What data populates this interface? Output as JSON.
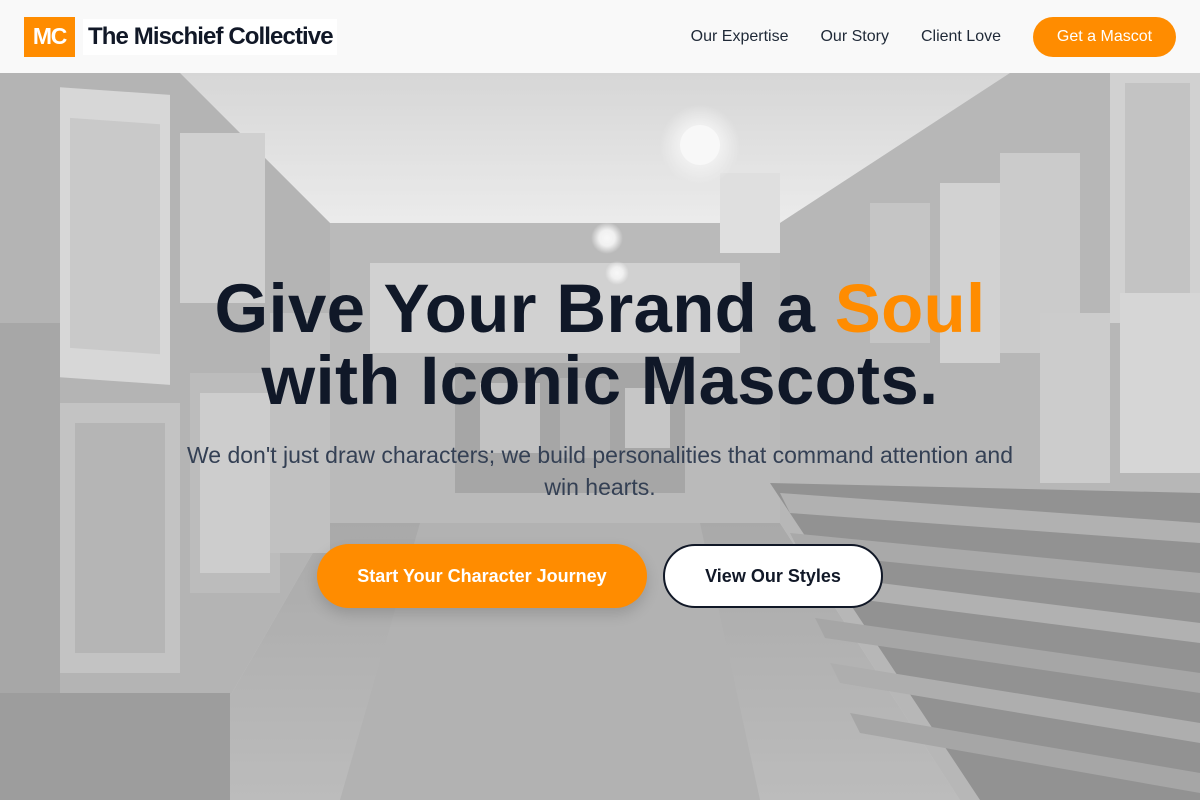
{
  "header": {
    "logo_mark": "MC",
    "brand_name": "The Mischief Collective",
    "nav": [
      {
        "label": "Our Expertise"
      },
      {
        "label": "Our Story"
      },
      {
        "label": "Client Love"
      }
    ],
    "cta_label": "Get a Mascot"
  },
  "hero": {
    "title_part1": "Give Your Brand a ",
    "title_accent": "Soul",
    "title_line2": "with Iconic Mascots.",
    "subtitle": "We don't just draw characters; we build personalities that command attention and win hearts.",
    "primary_button": "Start Your Character Journey",
    "secondary_button": "View Our Styles"
  },
  "colors": {
    "accent": "#ff8c00",
    "heading": "#101828",
    "body_text": "#344054"
  },
  "background_image": "grayscale-art-gallery-corridor"
}
